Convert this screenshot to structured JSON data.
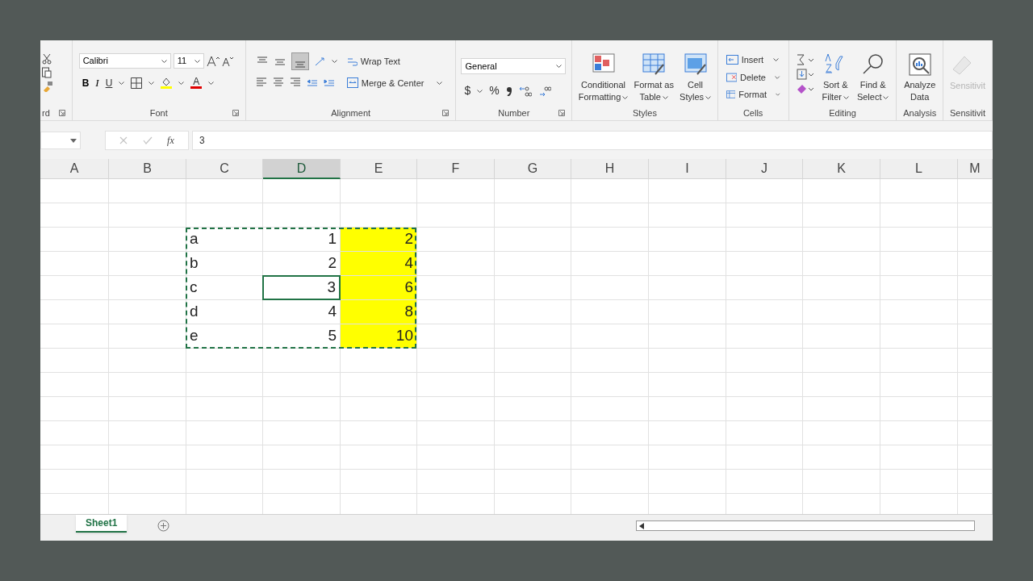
{
  "ribbon": {
    "groups": [
      {
        "kind": "clipboard",
        "label": "rd"
      },
      {
        "kind": "font",
        "label": "Font",
        "font_name": "Calibri",
        "font_size": "11",
        "bold": "B",
        "italic": "I",
        "underline": "U",
        "font_color": "A"
      },
      {
        "kind": "alignment",
        "label": "Alignment",
        "wrap_text": "Wrap Text",
        "merge": "Merge & Center"
      },
      {
        "kind": "number",
        "label": "Number",
        "format": "General",
        "currency": "$",
        "percent": "%"
      },
      {
        "kind": "big_buttons",
        "label": "Styles",
        "buttons": [
          {
            "lines": [
              "Conditional",
              "Formatting"
            ]
          },
          {
            "lines": [
              "Format as",
              "Table"
            ]
          },
          {
            "lines": [
              "Cell",
              "Styles"
            ]
          }
        ]
      },
      {
        "kind": "cells",
        "label": "Cells",
        "buttons": [
          "Insert",
          "Delete",
          "Format"
        ]
      },
      {
        "kind": "editing",
        "label": "Editing",
        "buttons": [
          {
            "lines": [
              "Sort &",
              "Filter"
            ]
          },
          {
            "lines": [
              "Find &",
              "Select"
            ]
          }
        ]
      },
      {
        "kind": "analysis",
        "label": "Analysis",
        "buttons": [
          {
            "lines": [
              "Analyze",
              "Data"
            ]
          }
        ]
      },
      {
        "kind": "disabled_button",
        "label": "Sensitivit",
        "button": "Sensitivit"
      }
    ]
  },
  "formula_bar": {
    "fx": "fx",
    "value": "3"
  },
  "grid": {
    "columns": [
      {
        "label": "A",
        "selected": false
      },
      {
        "label": "B",
        "selected": false
      },
      {
        "label": "C",
        "selected": false
      },
      {
        "label": "D",
        "selected": true
      },
      {
        "label": "E",
        "selected": false
      },
      {
        "label": "F",
        "selected": false
      },
      {
        "label": "G",
        "selected": false
      },
      {
        "label": "H",
        "selected": false
      },
      {
        "label": "I",
        "selected": false
      },
      {
        "label": "J",
        "selected": false
      },
      {
        "label": "K",
        "selected": false
      },
      {
        "label": "L",
        "selected": false
      },
      {
        "label": "M",
        "selected": false
      }
    ],
    "rows": [
      {},
      {},
      {
        "cells": [
          {
            "value": "a",
            "kind": "text",
            "selected": false,
            "copied": true
          },
          {
            "value": "1",
            "kind": "number",
            "selected": false,
            "copied": true
          },
          {
            "value": "2",
            "kind": "number",
            "selected": false,
            "copied": true,
            "color": "#ffff00"
          }
        ]
      },
      {
        "cells": [
          {
            "value": "b",
            "kind": "text",
            "selected": false,
            "copied": true
          },
          {
            "value": "2",
            "kind": "number",
            "selected": false,
            "copied": true
          },
          {
            "value": "4",
            "kind": "number",
            "selected": false,
            "copied": true,
            "color": "#ffff00"
          }
        ]
      },
      {
        "cells": [
          {
            "value": "c",
            "kind": "text",
            "selected": false,
            "copied": true
          },
          {
            "value": "3",
            "kind": "number",
            "selected": true,
            "copied": true
          },
          {
            "value": "6",
            "kind": "number",
            "selected": false,
            "copied": true,
            "color": "#ffff00"
          }
        ]
      },
      {
        "cells": [
          {
            "value": "d",
            "kind": "text",
            "selected": false,
            "copied": true
          },
          {
            "value": "4",
            "kind": "number",
            "selected": false,
            "copied": true
          },
          {
            "value": "8",
            "kind": "number",
            "selected": false,
            "copied": true,
            "color": "#ffff00"
          }
        ]
      },
      {
        "cells": [
          {
            "value": "e",
            "kind": "text",
            "selected": false,
            "copied": true
          },
          {
            "value": "5",
            "kind": "number",
            "selected": false,
            "copied": true
          },
          {
            "value": "10",
            "kind": "number",
            "selected": false,
            "copied": true,
            "color": "#ffff00"
          }
        ]
      },
      {},
      {},
      {},
      {},
      {},
      {},
      {}
    ]
  },
  "sheet_tabs": [
    {
      "label": "Sheet1",
      "selected": true
    }
  ]
}
